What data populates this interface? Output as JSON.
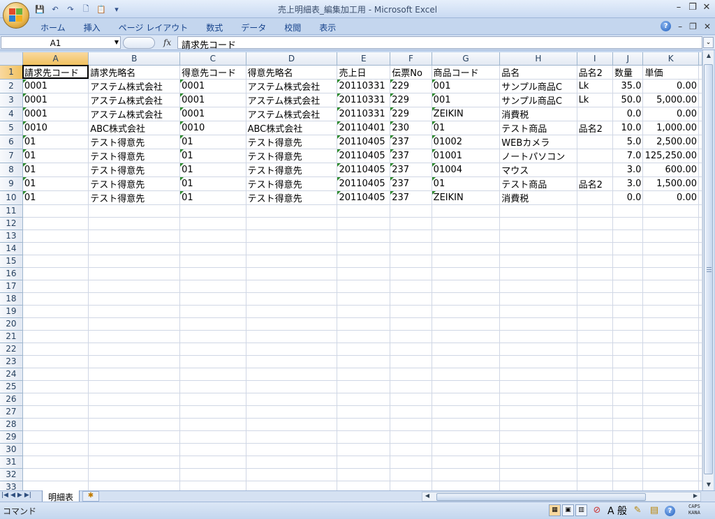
{
  "window": {
    "title": "売上明細表_編集加工用 - Microsoft Excel",
    "minimize": "–",
    "maximize": "❐",
    "close": "✕"
  },
  "ribbon": {
    "tabs": [
      "ホーム",
      "挿入",
      "ページ レイアウト",
      "数式",
      "データ",
      "校閲",
      "表示"
    ],
    "help": "?"
  },
  "formula_bar": {
    "name_box": "A1",
    "fx": "fx",
    "content": "請求先コード"
  },
  "sheet": {
    "columns": [
      "A",
      "B",
      "C",
      "D",
      "E",
      "F",
      "G",
      "H",
      "I",
      "J",
      "K"
    ],
    "selected_column": "A",
    "selected_row": 1,
    "header_row": [
      "請求先コード",
      "請求先略名",
      "得意先コード",
      "得意先略名",
      "売上日",
      "伝票No",
      "商品コード",
      "品名",
      "品名2",
      "数量",
      "単価"
    ],
    "rows": [
      [
        "0001",
        "アステム株式会社",
        "0001",
        "アステム株式会社",
        "20110331",
        "229",
        "001",
        "サンプル商品C",
        "Lk",
        "35.0",
        "0.00"
      ],
      [
        "0001",
        "アステム株式会社",
        "0001",
        "アステム株式会社",
        "20110331",
        "229",
        "001",
        "サンプル商品C",
        "Lk",
        "50.0",
        "5,000.00"
      ],
      [
        "0001",
        "アステム株式会社",
        "0001",
        "アステム株式会社",
        "20110331",
        "229",
        "ZEIKIN",
        "消費税",
        "",
        "0.0",
        "0.00"
      ],
      [
        "0010",
        "ABC株式会社",
        "0010",
        "ABC株式会社",
        "20110401",
        "230",
        "01",
        "テスト商品",
        "品名2",
        "10.0",
        "1,000.00"
      ],
      [
        "01",
        "テスト得意先",
        "01",
        "テスト得意先",
        "20110405",
        "237",
        "01002",
        "WEBカメラ",
        "",
        "5.0",
        "2,500.00"
      ],
      [
        "01",
        "テスト得意先",
        "01",
        "テスト得意先",
        "20110405",
        "237",
        "01001",
        "ノートパソコン",
        "",
        "7.0",
        "125,250.00"
      ],
      [
        "01",
        "テスト得意先",
        "01",
        "テスト得意先",
        "20110405",
        "237",
        "01004",
        "マウス",
        "",
        "3.0",
        "600.00"
      ],
      [
        "01",
        "テスト得意先",
        "01",
        "テスト得意先",
        "20110405",
        "237",
        "01",
        "テスト商品",
        "品名2",
        "3.0",
        "1,500.00"
      ],
      [
        "01",
        "テスト得意先",
        "01",
        "テスト得意先",
        "20110405",
        "237",
        "ZEIKIN",
        "消費税",
        "",
        "0.0",
        "0.00"
      ]
    ],
    "total_rows_visible": 34
  },
  "sheet_tabs": {
    "active": "明細表"
  },
  "status_bar": {
    "mode": "コマンド",
    "ime_mode": "A 般",
    "caps": "CAPS",
    "kana": "KANA"
  },
  "colors": {
    "accent": "#15428b",
    "grid_line": "#d0d7e5",
    "selected_header": "#f1c15f",
    "text_number_marker": "#2e8b2e"
  }
}
